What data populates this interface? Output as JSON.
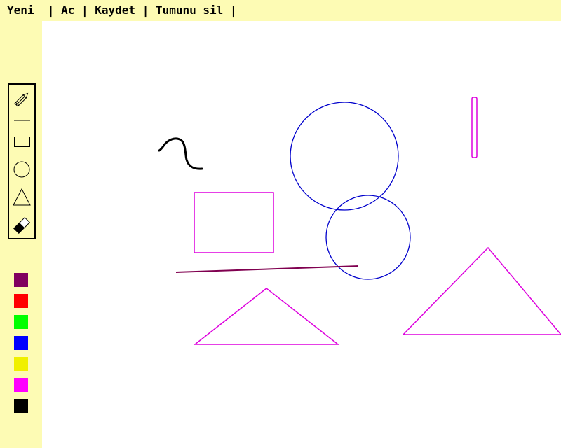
{
  "menu": {
    "new_label": "Yeni",
    "open_label": "Ac",
    "save_label": "Kaydet",
    "clear_label": "Tumunu sil",
    "separator": "|"
  },
  "tools": [
    {
      "name": "pencil-icon"
    },
    {
      "name": "line-icon"
    },
    {
      "name": "rectangle-icon"
    },
    {
      "name": "circle-icon"
    },
    {
      "name": "triangle-icon"
    },
    {
      "name": "eraser-icon"
    }
  ],
  "palette": [
    "#800060",
    "#ff0000",
    "#00ff00",
    "#0000ff",
    "#f0f000",
    "#ff00ff",
    "#000000"
  ],
  "colors": {
    "background": "#fdfbb4",
    "canvas": "#ffffff",
    "circle_stroke": "#0000cc",
    "rect_stroke": "#dd00dd",
    "line_stroke": "#800050",
    "freehand_stroke": "#000000"
  }
}
